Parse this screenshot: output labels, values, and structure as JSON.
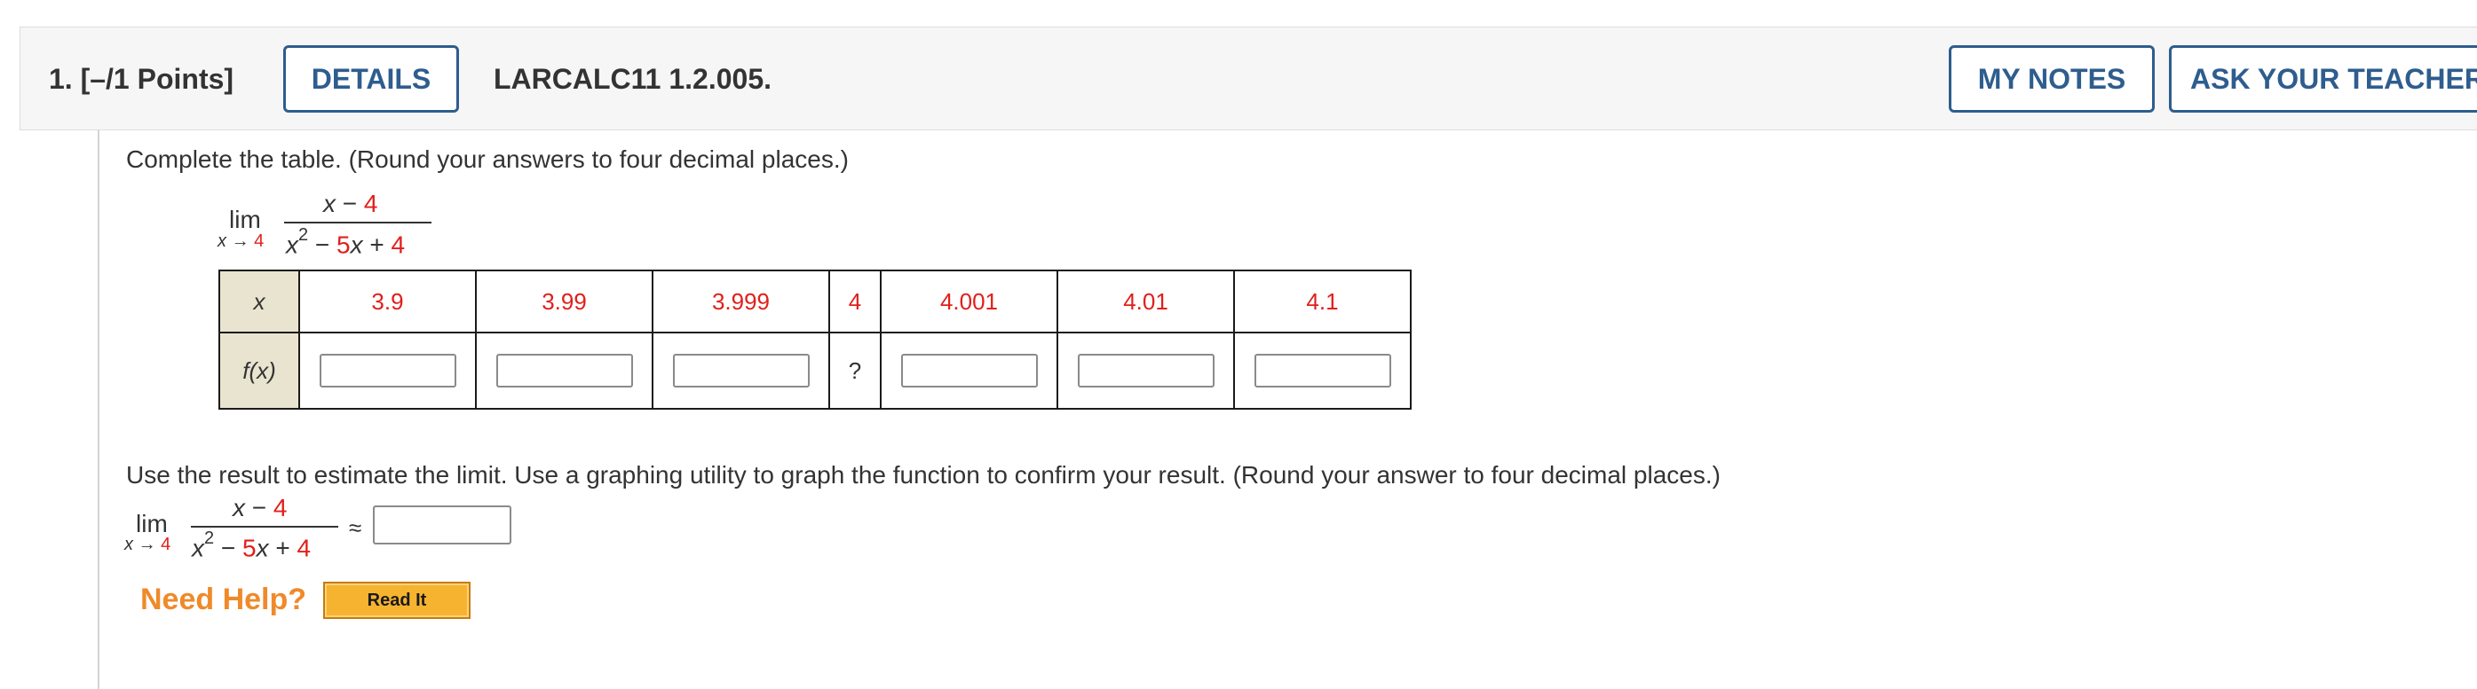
{
  "header": {
    "question_number": "1.",
    "points": "[–/1 Points]",
    "details_label": "DETAILS",
    "problem_code": "LARCALC11 1.2.005.",
    "my_notes_label": "MY NOTES",
    "ask_teacher_label": "ASK YOUR TEACHER"
  },
  "question": {
    "instruction": "Complete the table. (Round your answers to four decimal places.)",
    "limit": {
      "lim": "lim",
      "sub_var": "x",
      "sub_arrow": "→",
      "sub_value": "4",
      "num_var": "x",
      "num_minus": " − ",
      "num_const": "4",
      "den_var": "x",
      "den_exp": "2",
      "den_minus": " − ",
      "den_coef": "5",
      "den_var2": "x",
      "den_plus": " + ",
      "den_const": "4"
    },
    "table": {
      "x_header": "x",
      "fx_header": "f(x)",
      "x_values": [
        "3.9",
        "3.99",
        "3.999",
        "4",
        "4.001",
        "4.01",
        "4.1"
      ],
      "fx_unknown_at_4": "?"
    },
    "instruction2": "Use the result to estimate the limit. Use a graphing utility to graph the function to confirm your result. (Round your answer to four decimal places.)",
    "approx_symbol": "≈"
  },
  "help": {
    "need_help": "Need Help?",
    "read_it": "Read It"
  },
  "colors": {
    "accent_blue": "#2e5d8e",
    "given_value_red": "#e0201c",
    "help_orange": "#ef8a2a",
    "button_gold": "#f6b330"
  }
}
